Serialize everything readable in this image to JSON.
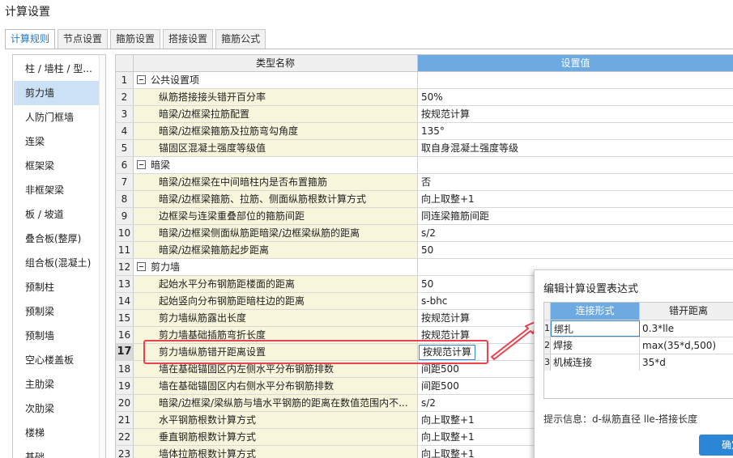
{
  "window": {
    "title": "计算设置"
  },
  "tabs": [
    {
      "label": "计算规则",
      "active": true
    },
    {
      "label": "节点设置"
    },
    {
      "label": "箍筋设置"
    },
    {
      "label": "搭接设置"
    },
    {
      "label": "箍筋公式"
    }
  ],
  "sidebar": {
    "items": [
      {
        "label": "柱 / 墙柱 / 型..."
      },
      {
        "label": "剪力墙",
        "active": true
      },
      {
        "label": "人防门框墙"
      },
      {
        "label": "连梁"
      },
      {
        "label": "框架梁"
      },
      {
        "label": "非框架梁"
      },
      {
        "label": "板 / 坡道"
      },
      {
        "label": "叠合板(整厚)"
      },
      {
        "label": "组合板(混凝土)"
      },
      {
        "label": "预制柱"
      },
      {
        "label": "预制梁"
      },
      {
        "label": "预制墙"
      },
      {
        "label": "空心楼盖板"
      },
      {
        "label": "主肋梁"
      },
      {
        "label": "次肋梁"
      },
      {
        "label": "楼梯"
      },
      {
        "label": "基础"
      }
    ]
  },
  "grid": {
    "header": {
      "name": "类型名称",
      "value": "设置值"
    },
    "rows": [
      {
        "num": "1",
        "name": "公共设置项",
        "value": "",
        "group": true
      },
      {
        "num": "2",
        "name": "纵筋搭接接头错开百分率",
        "value": "50%"
      },
      {
        "num": "3",
        "name": "暗梁/边框梁拉筋配置",
        "value": "按规范计算"
      },
      {
        "num": "4",
        "name": "暗梁/边框梁箍筋及拉筋弯勾角度",
        "value": "135°"
      },
      {
        "num": "5",
        "name": "锚固区混凝土强度等级值",
        "value": "取自身混凝土强度等级"
      },
      {
        "num": "6",
        "name": "暗梁",
        "value": "",
        "group": true
      },
      {
        "num": "7",
        "name": "暗梁/边框梁在中间暗柱内是否布置箍筋",
        "value": "否"
      },
      {
        "num": "8",
        "name": "暗梁/边框梁箍筋、拉筋、侧面纵筋根数计算方式",
        "value": "向上取整+1"
      },
      {
        "num": "9",
        "name": "边框梁与连梁重叠部位的箍筋间距",
        "value": "同连梁箍筋间距"
      },
      {
        "num": "10",
        "name": "暗梁/边框梁侧面纵筋距暗梁/边框梁纵筋的距离",
        "value": "s/2"
      },
      {
        "num": "11",
        "name": "暗梁/边框梁箍筋起步距离",
        "value": "50"
      },
      {
        "num": "12",
        "name": "剪力墙",
        "value": "",
        "group": true
      },
      {
        "num": "13",
        "name": "起始水平分布钢筋距楼面的距离",
        "value": "50"
      },
      {
        "num": "14",
        "name": "起始竖向分布钢筋距暗柱边的距离",
        "value": "s-bhc"
      },
      {
        "num": "15",
        "name": "剪力墙纵筋露出长度",
        "value": "按规范计算"
      },
      {
        "num": "16",
        "name": "剪力墙基础插筋弯折长度",
        "value": "按规范计算"
      },
      {
        "num": "17",
        "name": "剪力墙纵筋错开距离设置",
        "value": "按规范计算",
        "selected": true
      },
      {
        "num": "18",
        "name": "墙在基础锚固区内左侧水平分布钢筋排数",
        "value": "间距500"
      },
      {
        "num": "19",
        "name": "墙在基础锚固区内右侧水平分布钢筋排数",
        "value": "间距500"
      },
      {
        "num": "20",
        "name": "暗梁/边框梁/梁纵筋与墙水平钢筋的距离在数值范围内不...",
        "value": "s/2"
      },
      {
        "num": "21",
        "name": "水平钢筋根数计算方式",
        "value": "向上取整+1"
      },
      {
        "num": "22",
        "name": "垂直钢筋根数计算方式",
        "value": "向上取整+1"
      },
      {
        "num": "23",
        "name": "墙体拉筋根数计算方式",
        "value": "向上取整+1"
      }
    ]
  },
  "dialog": {
    "title": "编辑计算设置表达式",
    "table": {
      "headers": [
        "连接形式",
        "错开距离"
      ],
      "rows": [
        {
          "num": "1",
          "type": "绑扎",
          "distance": "0.3*lle"
        },
        {
          "num": "2",
          "type": "焊接",
          "distance": "max(35*d,500)"
        },
        {
          "num": "3",
          "type": "机械连接",
          "distance": "35*d"
        }
      ]
    },
    "hint": "提示信息：d-纵筋直径  lle-搭接长度",
    "ok_label": "确定"
  },
  "colors": {
    "accent": "#6daae2",
    "highlight": "#e8434f",
    "child_row": "#f7f5dc",
    "button": "#2b86d6"
  }
}
